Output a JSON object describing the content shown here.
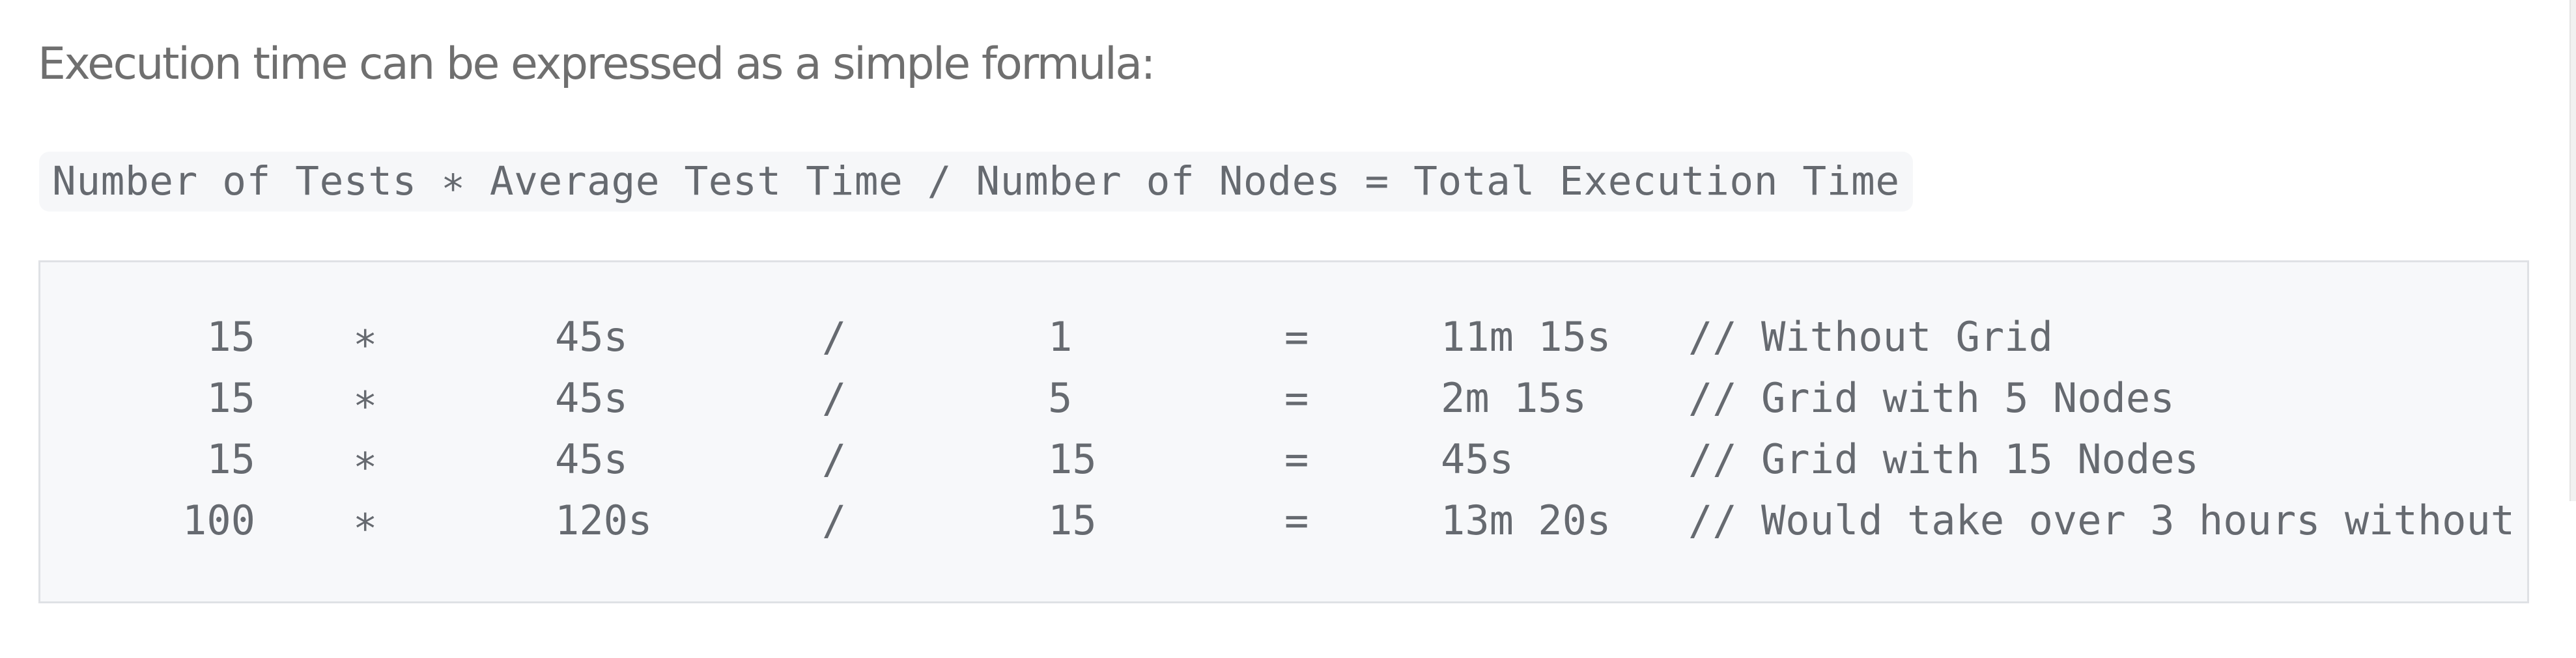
{
  "intro_text": "Execution time can be expressed as a simple formula:",
  "formula_text": "Number of Tests ∗ Average Test Time / Number of Nodes = Total Execution Time",
  "code_rows": [
    {
      "tests": "15",
      "times": "∗",
      "avg": "45s",
      "div": "/",
      "nodes": "1",
      "eq": "=",
      "total": "11m 15s",
      "comment": "// Without Grid"
    },
    {
      "tests": "15",
      "times": "∗",
      "avg": "45s",
      "div": "/",
      "nodes": "5",
      "eq": "=",
      "total": "2m 15s",
      "comment": "// Grid with 5 Nodes"
    },
    {
      "tests": "15",
      "times": "∗",
      "avg": "45s",
      "div": "/",
      "nodes": "15",
      "eq": "=",
      "total": "45s",
      "comment": "// Grid with 15 Nodes"
    },
    {
      "tests": "100",
      "times": "∗",
      "avg": "120s",
      "div": "/",
      "nodes": "15",
      "eq": "=",
      "total": "13m 20s",
      "comment": "// Would take over 3 hours without"
    }
  ],
  "colors": {
    "text": "#6f6f6f",
    "code_text": "#666a70",
    "code_background": "#f7f8fa",
    "code_border": "#dfe1e5",
    "inline_code_background": "#f6f7f9"
  }
}
